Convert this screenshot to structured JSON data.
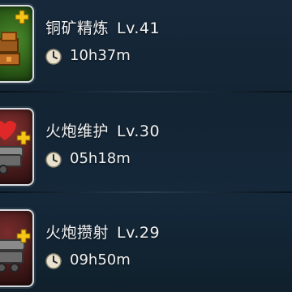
{
  "research_list": [
    {
      "name": "铜矿精炼",
      "level": "Lv.41",
      "time": "10h37m",
      "icon": "copper-ore-refining-icon",
      "tile_color": "#2f6119"
    },
    {
      "name": "火炮维护",
      "level": "Lv.30",
      "time": "05h18m",
      "icon": "artillery-maintenance-icon",
      "tile_color": "#4e1e1e"
    },
    {
      "name": "火炮攒射",
      "level": "Lv.29",
      "time": "09h50m",
      "icon": "artillery-barrage-icon",
      "tile_color": "#461b1b"
    }
  ],
  "colors": {
    "text": "#f2f2f2",
    "plus_badge": "#f5c518",
    "clock_face": "#e8e2cf"
  }
}
